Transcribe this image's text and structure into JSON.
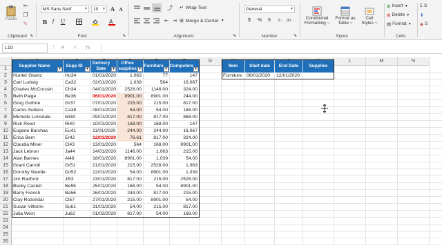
{
  "ribbon": {
    "clipboard": {
      "label": "Clipboard",
      "paste": "Paste"
    },
    "font": {
      "label": "Font",
      "name": "MS Sans Serif",
      "size": "10",
      "bold": "B",
      "italic": "I",
      "underline": "U",
      "grow": "A",
      "shrink": "A"
    },
    "alignment": {
      "label": "Alignment",
      "wrap_text": "Wrap Text",
      "merge_center": "Merge & Center"
    },
    "number": {
      "label": "Number",
      "format": "General",
      "currency": "$",
      "percent": "%",
      "comma": "9"
    },
    "styles": {
      "label": "Styles",
      "conditional": "Conditional",
      "conditional2": "Formatting ~",
      "format_as": "Format as",
      "format_as2": "Table ~",
      "cell": "Cell",
      "cell2": "Styles ~"
    },
    "cells": {
      "label": "Cells",
      "insert": "Insert",
      "delete": "Delete",
      "format": "Format"
    },
    "editing_partial": [
      "S",
      "S"
    ]
  },
  "formula_bar": {
    "name_box": "L10",
    "cancel": "✕",
    "enter": "✓",
    "fx": "fx",
    "content": ""
  },
  "columns": [
    "A",
    "B",
    "C",
    "D",
    "E",
    "F",
    "G",
    "H",
    "I",
    "J",
    "K",
    "L",
    "M",
    "N"
  ],
  "rows": [
    "1",
    "2",
    "3",
    "4",
    "5",
    "6",
    "7",
    "8",
    "9",
    "10",
    "11",
    "12",
    "13",
    "14",
    "15",
    "16",
    "17",
    "18",
    "19",
    "20",
    "21",
    "22",
    "23",
    "24",
    "25",
    "26"
  ],
  "table": {
    "headers": [
      "Supplier Name",
      "Supp ID",
      "Delivery Date",
      "Office supplies",
      "Furniture",
      "Computers"
    ],
    "rows": [
      [
        "Hunter Glantz",
        "Hu34",
        "01/01/2020",
        "1,063",
        "77",
        "147"
      ],
      [
        "Carl Ludwig",
        "Ca32",
        "02/01/2020",
        "1,039",
        "564",
        "16,067"
      ],
      [
        "Charles McCrossin",
        "Ch34",
        "04/01/2020",
        "2528.00",
        "1146.00",
        "324.00"
      ],
      [
        "Beth Paige",
        "Be36",
        "06/01/2020",
        "8901.00",
        "8901.00",
        "244.00"
      ],
      [
        "Greg Guthrie",
        "Gr37",
        "07/01/2020",
        "215.00",
        "215.00",
        "817.00"
      ],
      [
        "Carlos Soltero",
        "Ca38",
        "08/01/2020",
        "54.00",
        "54.00",
        "168.00"
      ],
      [
        "Michelle Lonsdale",
        "Mi39",
        "09/01/2020",
        "817.00",
        "817.00",
        "868.00"
      ],
      [
        "Rick Reed",
        "Ri40",
        "10/01/2020",
        "168.00",
        "168.00",
        "147"
      ],
      [
        "Eugene Barchas",
        "Eu41",
        "11/01/2020",
        "244.00",
        "244.00",
        "16,067"
      ],
      [
        "Erica Bern",
        "Er42",
        "12/01/2020",
        "76.61",
        "817.00",
        "324.00"
      ],
      [
        "Claudia Miner",
        "Cl43",
        "13/01/2020",
        "564",
        "168.00",
        "8901.00"
      ],
      [
        "Jack Lebron",
        "Ja44",
        "14/01/2020",
        "1146.00",
        "1,063",
        "215.00"
      ],
      [
        "Alan Barnes",
        "Al48",
        "18/01/2020",
        "8901.00",
        "1,039",
        "54.00"
      ],
      [
        "Grant Carroll",
        "Gr51",
        "21/01/2020",
        "215.00",
        "2528.00",
        "1,063"
      ],
      [
        "Dorothy Wardle",
        "Do52",
        "22/01/2020",
        "54.00",
        "8901.00",
        "1,039"
      ],
      [
        "Jim Radford",
        "Ji53",
        "23/01/2020",
        "817.00",
        "215.00",
        "2528.00"
      ],
      [
        "Becky Castell",
        "Be55",
        "25/01/2020",
        "168.00",
        "54.00",
        "8901.00"
      ],
      [
        "Barry French",
        "Ba56",
        "26/01/2020",
        "244.00",
        "817.00",
        "215.00"
      ],
      [
        "Clay Rozendal",
        "Cl57",
        "27/01/2020",
        "215.00",
        "8901.00",
        "54.00"
      ],
      [
        "Susan Vittorini",
        "Su61",
        "31/01/2020",
        "54.00",
        "215.00",
        "817.00"
      ],
      [
        "Julia West",
        "Ju62",
        "01/02/2020",
        "817.00",
        "54.00",
        "168.00"
      ]
    ],
    "highlight_red_dates": [
      3,
      9
    ]
  },
  "criteria": {
    "headers": [
      "Item",
      "Start date",
      "End Date",
      "Supplies"
    ],
    "values": [
      "Furniture",
      "06/01/2020",
      "12/01/2020",
      ""
    ]
  },
  "colors": {
    "table_header": "#1f6fb9",
    "shade": "#f8e5d8",
    "red": "#e00000"
  }
}
